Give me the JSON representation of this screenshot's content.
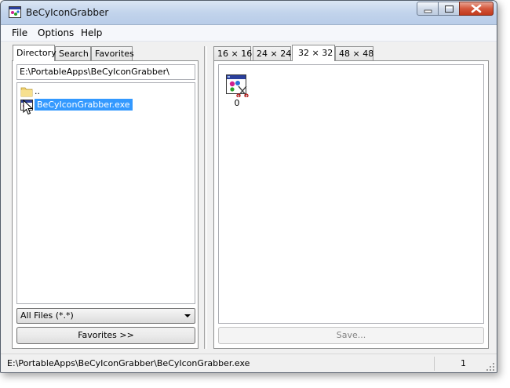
{
  "window": {
    "title": "BeCyIconGrabber",
    "icon": "app-icon",
    "controls": [
      "minimize-icon",
      "maximize-icon",
      "close-icon"
    ]
  },
  "menu": [
    {
      "label": "File"
    },
    {
      "label": "Options"
    },
    {
      "label": "Help"
    }
  ],
  "left_tabs": [
    {
      "label": "Directory",
      "active": true
    },
    {
      "label": "Search",
      "active": false
    },
    {
      "label": "Favorites",
      "active": false
    }
  ],
  "directory": {
    "path": "E:\\PortableApps\\BeCyIconGrabber\\",
    "items": [
      {
        "label": "..",
        "icon": "folder-icon",
        "selected": false
      },
      {
        "label": "BeCyIconGrabber.exe",
        "icon": "exe-icon",
        "selected": true
      }
    ],
    "filter": "All Files (*.*)",
    "favorites_button": "Favorites >>"
  },
  "size_tabs": [
    {
      "label": "16 × 16",
      "active": false
    },
    {
      "label": "24 × 24",
      "active": false
    },
    {
      "label": "32 × 32",
      "active": true
    },
    {
      "label": "48 × 48",
      "active": false
    }
  ],
  "icons": [
    {
      "caption": "0",
      "icon": "extracted-app-icon"
    }
  ],
  "save_button": "Save...",
  "status": {
    "path": "E:\\PortableApps\\BeCyIconGrabber\\BeCyIconGrabber.exe",
    "count": "1"
  },
  "colors": {
    "selection": "#3399ff",
    "title_gradient_top": "#dbe6f4",
    "close_button": "#c0391c"
  }
}
